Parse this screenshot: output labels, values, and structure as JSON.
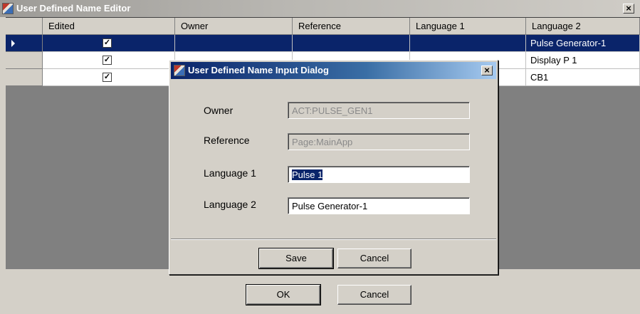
{
  "window": {
    "title": "User Defined Name Editor",
    "close_glyph": "×"
  },
  "grid": {
    "columns": [
      "Edited",
      "Owner",
      "Reference",
      "Language 1",
      "Language 2"
    ],
    "rows": [
      {
        "edited": true,
        "language2": "Pulse Generator-1",
        "selected": true
      },
      {
        "edited": true,
        "language2": "Display P 1",
        "selected": false
      },
      {
        "edited": true,
        "language2": "CB1",
        "selected": false
      }
    ],
    "check_glyph": "✓",
    "selection_color": "#0a246a"
  },
  "dialog": {
    "title": "User Defined Name Input Dialog",
    "close_glyph": "×",
    "fields": {
      "owner": {
        "label": "Owner",
        "value": "ACT:PULSE_GEN1"
      },
      "reference": {
        "label": "Reference",
        "value": "Page:MainApp"
      },
      "language1": {
        "label": "Language 1",
        "value": "Pulse 1"
      },
      "language2": {
        "label": "Language 2",
        "value": "Pulse Generator-1"
      }
    },
    "save_label": "Save",
    "cancel_label": "Cancel"
  },
  "footer": {
    "ok_label": "OK",
    "cancel_label": "Cancel"
  },
  "icons": {
    "app": "app-icon",
    "close": "close-icon",
    "row_indicator": "row-pointer-icon"
  }
}
